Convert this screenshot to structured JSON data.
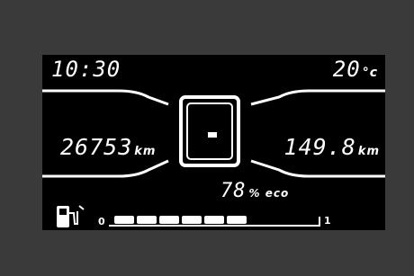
{
  "display": {
    "clock": "10:30",
    "temperature": {
      "value": "20",
      "unit": "°c"
    },
    "odometer": {
      "value": "26753",
      "unit": "km"
    },
    "trip": {
      "value": "149.8",
      "unit": "km"
    },
    "eco": {
      "value": "78",
      "unit": "% eco"
    },
    "fuel": {
      "empty_label": "0",
      "full_label": "1",
      "segments_total": 9,
      "segments_filled": 6
    },
    "icons": {
      "fuel": "fuel-pump-icon"
    },
    "colors": {
      "screen": "#000000",
      "bezel": "#3a3a3a",
      "segment": "#ffffff"
    }
  }
}
